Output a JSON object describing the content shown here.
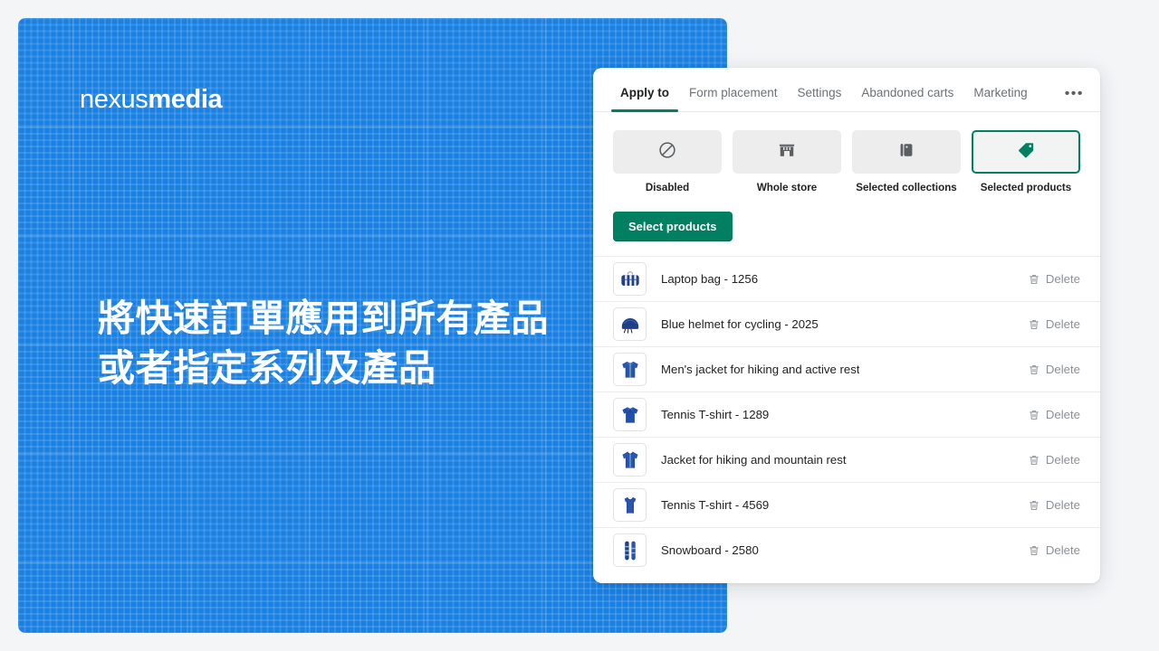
{
  "hero": {
    "logo_light": "nexus",
    "logo_bold": "media",
    "headline_line1": "將快速訂單應用到所有產品",
    "headline_line2": "或者指定系列及產品",
    "background_color": "#1a81e3"
  },
  "card": {
    "tabs": [
      {
        "label": "Apply to",
        "active": true
      },
      {
        "label": "Form placement",
        "active": false
      },
      {
        "label": "Settings",
        "active": false
      },
      {
        "label": "Abandoned carts",
        "active": false
      },
      {
        "label": "Marketing",
        "active": false
      }
    ],
    "overflow_label": "•••",
    "accent_color": "#008060",
    "options": [
      {
        "label": "Disabled",
        "icon": "no-entry-icon",
        "selected": false
      },
      {
        "label": "Whole store",
        "icon": "storefront-icon",
        "selected": false
      },
      {
        "label": "Selected collections",
        "icon": "collection-icon",
        "selected": false
      },
      {
        "label": "Selected products",
        "icon": "price-tag-icon",
        "selected": true
      }
    ],
    "select_products_label": "Select products",
    "delete_label": "Delete",
    "products": [
      {
        "title": "Laptop bag - 1256",
        "thumb": "laptop-bag-thumb"
      },
      {
        "title": "Blue helmet for cycling - 2025",
        "thumb": "helmet-thumb"
      },
      {
        "title": "Men's jacket for hiking and active rest",
        "thumb": "mens-jacket-thumb"
      },
      {
        "title": "Tennis T-shirt - 1289",
        "thumb": "polo-shirt-thumb"
      },
      {
        "title": "Jacket for hiking and mountain rest",
        "thumb": "hooded-jacket-thumb"
      },
      {
        "title": "Tennis T-shirt - 4569",
        "thumb": "tank-top-thumb"
      },
      {
        "title": "Snowboard - 2580",
        "thumb": "snowboard-thumb"
      }
    ]
  }
}
